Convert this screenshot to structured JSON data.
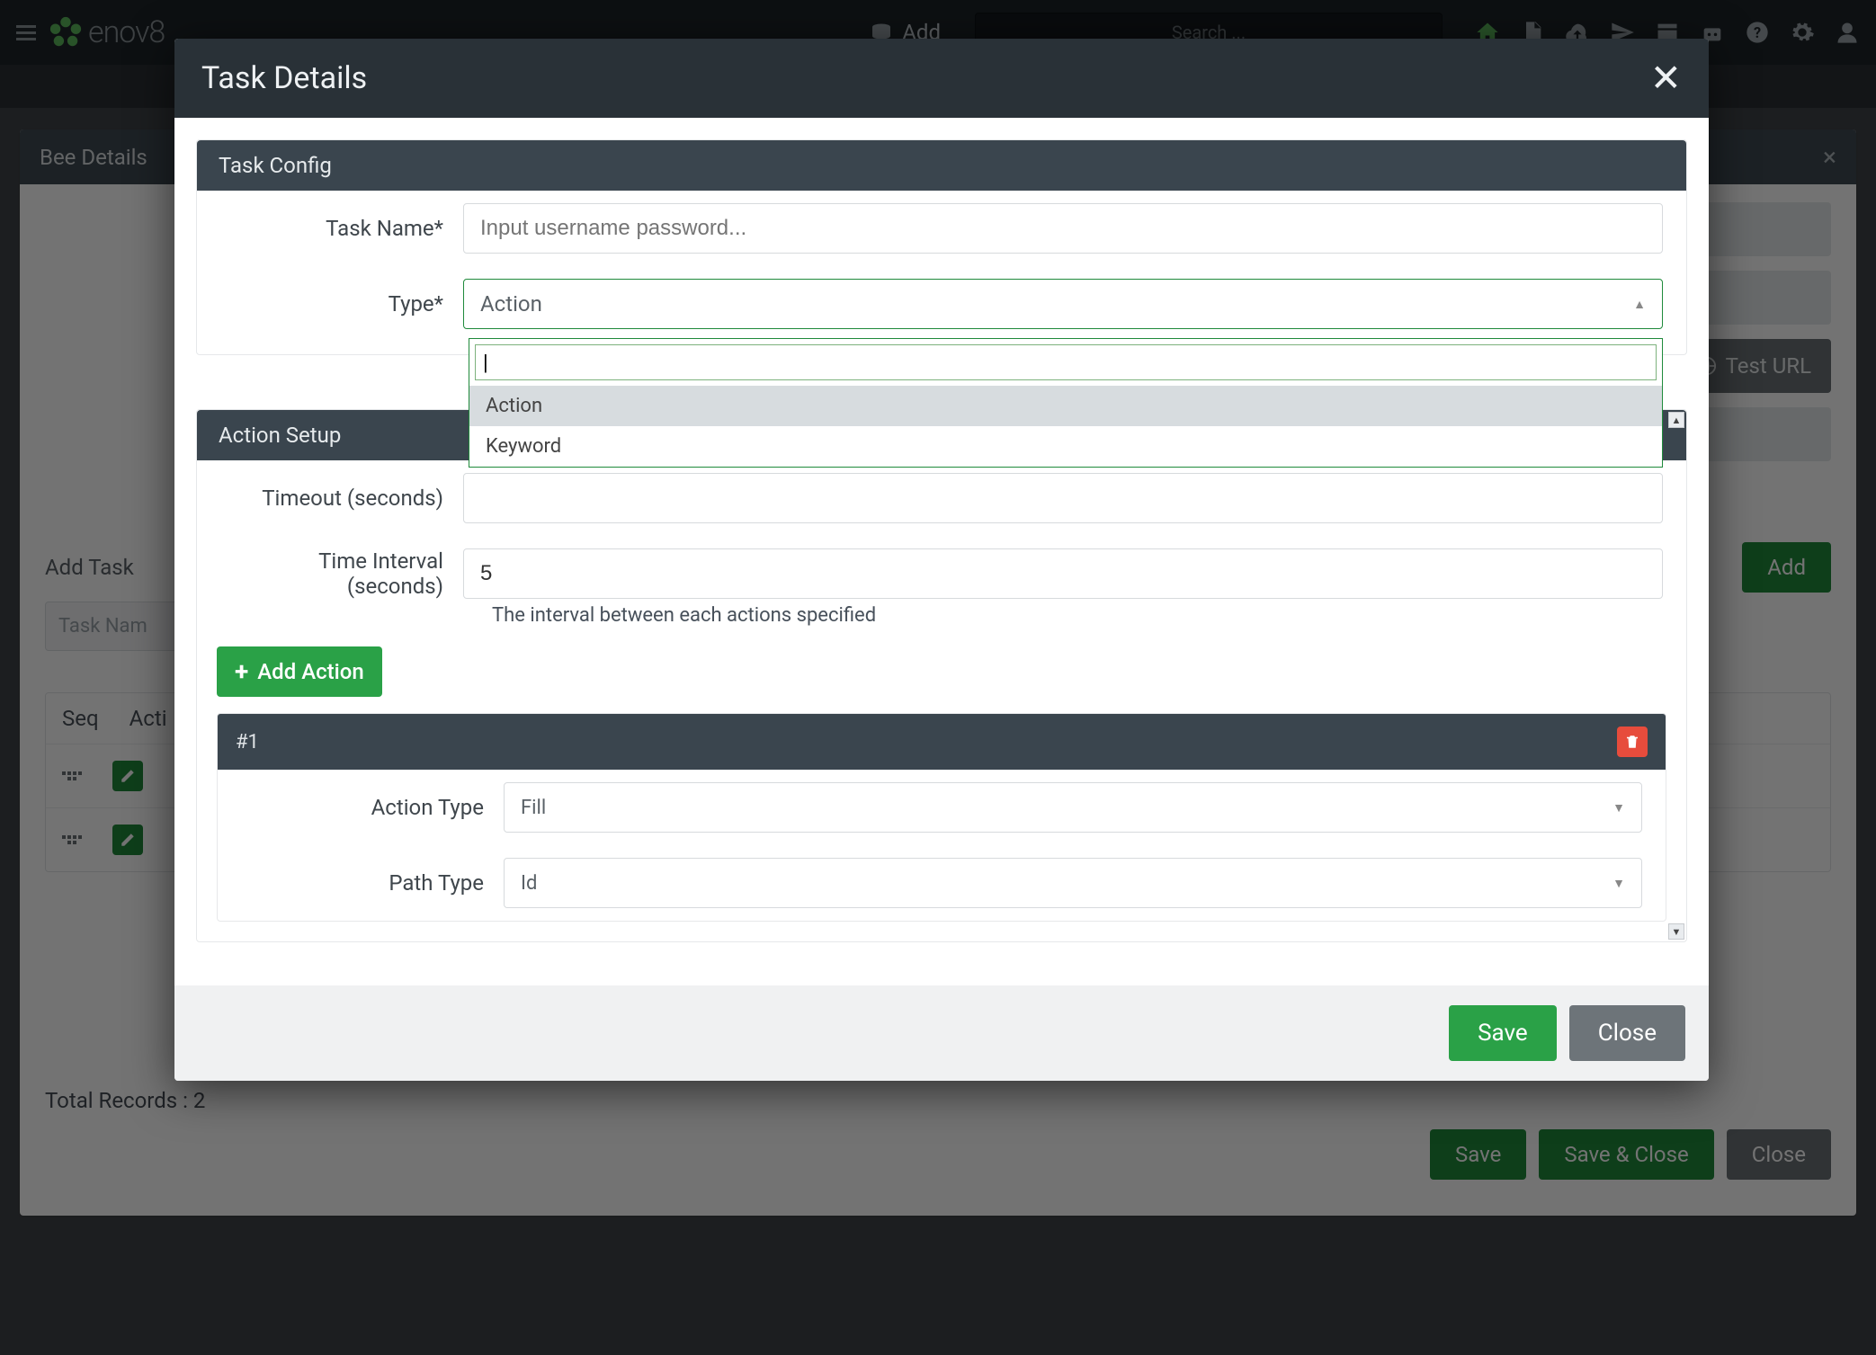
{
  "top": {
    "brand": "enov8",
    "add_label": "Add",
    "search_placeholder": "Search ..."
  },
  "bg": {
    "panel_title": "Bee Details",
    "test_url_label": "Test URL",
    "add_task_label": "Add Task",
    "task_name_placeholder": "Task Nam",
    "add_btn": "Add",
    "col_seq": "Seq",
    "col_act": "Acti",
    "total_records": "Total Records : 2",
    "save": "Save",
    "save_close": "Save & Close",
    "close": "Close"
  },
  "modal": {
    "title": "Task Details",
    "task_config_hdr": "Task Config",
    "task_name_label": "Task Name*",
    "task_name_placeholder": "Input username password...",
    "type_label": "Type*",
    "type_value": "Action",
    "type_options": [
      "Action",
      "Keyword"
    ],
    "action_setup_hdr": "Action Setup",
    "timeout_label": "Timeout (seconds)",
    "timeout_value": "",
    "interval_label": "Time Interval (seconds)",
    "interval_value": "5",
    "interval_help": "The interval between each actions specified",
    "add_action_label": "Add Action",
    "action1_hdr": "#1",
    "action_type_label": "Action Type",
    "action_type_value": "Fill",
    "path_type_label": "Path Type",
    "path_type_value": "Id",
    "save_label": "Save",
    "close_label": "Close"
  }
}
